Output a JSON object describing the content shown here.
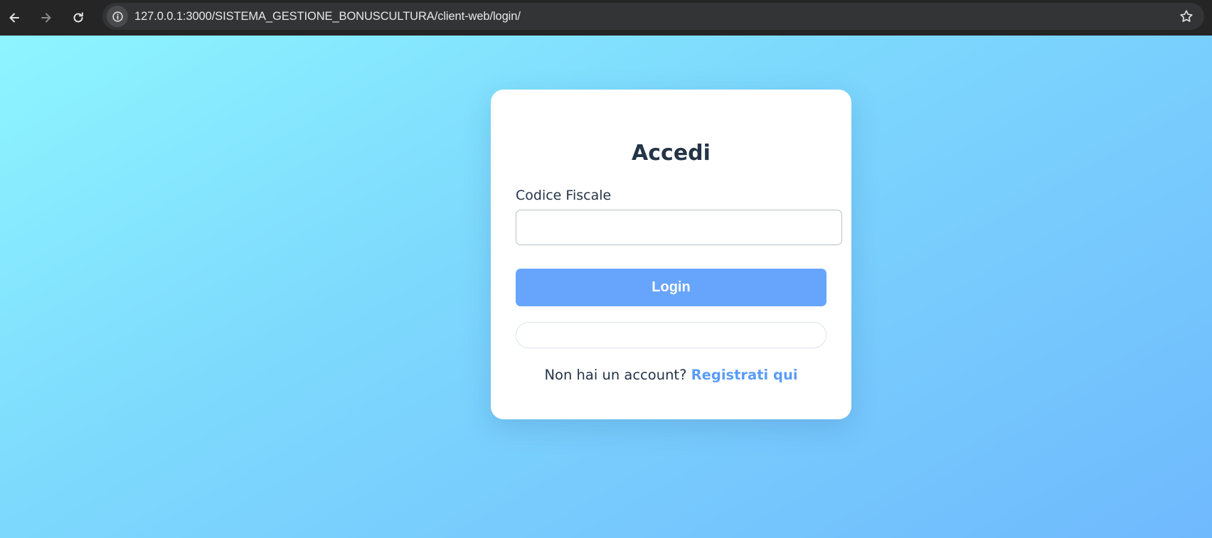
{
  "browser": {
    "url": "127.0.0.1:3000/SISTEMA_GESTIONE_BONUSCULTURA/client-web/login/",
    "icons": [
      "back-arrow-icon",
      "forward-arrow-icon",
      "reload-icon",
      "site-info-icon",
      "bookmark-star-icon"
    ]
  },
  "login": {
    "title": "Accedi",
    "field_label": "Codice Fiscale",
    "field_value": "",
    "button_label": "Login",
    "message": "",
    "register_prompt": "Non hai un account?",
    "register_link": "Registrati qui"
  },
  "colors": {
    "background_start": "#8ef5ff",
    "background_end": "#6fb9fd",
    "button": "#66a5fb",
    "link": "#5b9cf6",
    "text": "#243447"
  }
}
